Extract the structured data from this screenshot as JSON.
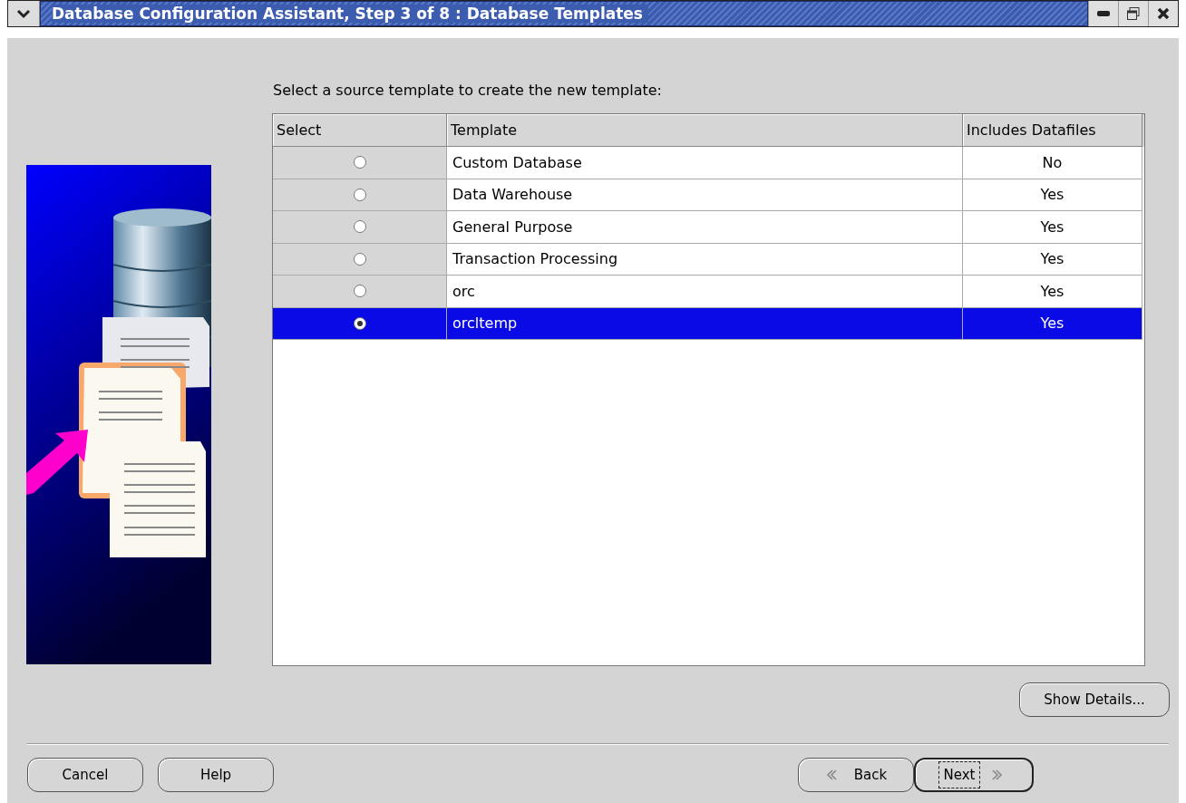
{
  "window": {
    "title": "Database Configuration Assistant, Step 3 of 8 : Database Templates"
  },
  "prompt": "Select a source template to create the new template:",
  "table": {
    "columns": [
      "Select",
      "Template",
      "Includes Datafiles"
    ],
    "rows": [
      {
        "template": "Custom Database",
        "includes_datafiles": "No",
        "selected": false
      },
      {
        "template": "Data Warehouse",
        "includes_datafiles": "Yes",
        "selected": false
      },
      {
        "template": "General Purpose",
        "includes_datafiles": "Yes",
        "selected": false
      },
      {
        "template": "Transaction Processing",
        "includes_datafiles": "Yes",
        "selected": false
      },
      {
        "template": "orc",
        "includes_datafiles": "Yes",
        "selected": false
      },
      {
        "template": "orcltemp",
        "includes_datafiles": "Yes",
        "selected": true
      }
    ]
  },
  "show_details_button": "Show Details...",
  "footer_buttons": [
    {
      "label": "Cancel",
      "kind": "plain",
      "focused": false
    },
    {
      "label": "Help",
      "kind": "plain",
      "focused": false
    },
    {
      "label": "Back",
      "kind": "back",
      "focused": false
    },
    {
      "label": "Next",
      "kind": "next",
      "focused": true
    }
  ]
}
